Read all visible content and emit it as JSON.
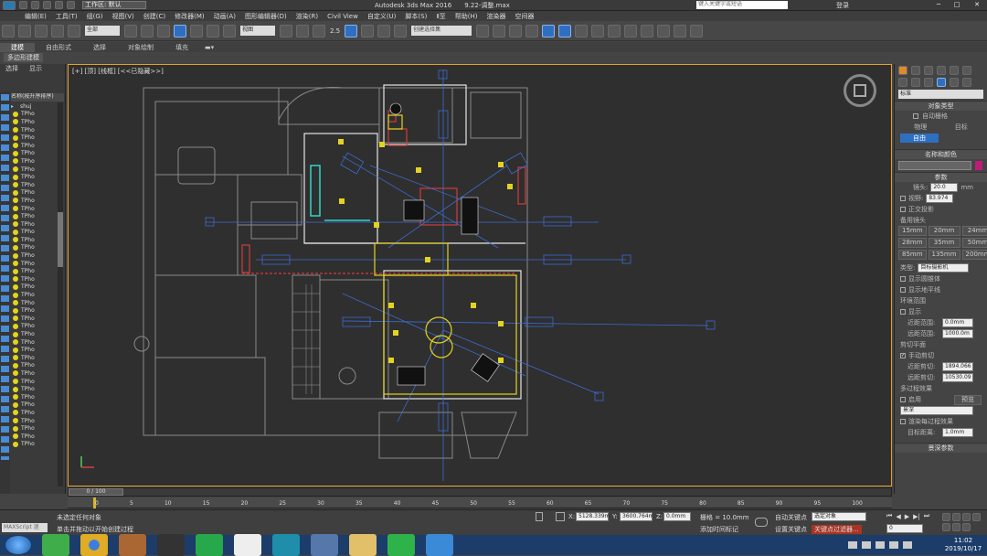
{
  "title_bar": {
    "workspace": "工作区: 默认",
    "app_title": "Autodesk 3ds Max 2016",
    "file_name": "9.22-调整.max",
    "search_placeholder": "键入关键字或短语",
    "user": "登录"
  },
  "menu": [
    "编辑(E)",
    "工具(T)",
    "组(G)",
    "视图(V)",
    "创建(C)",
    "修改器(M)",
    "动画(A)",
    "图形编辑器(D)",
    "渲染(R)",
    "Civil View",
    "自定义(U)",
    "脚本(S)",
    "Ⅱ至",
    "帮助(H)",
    "渲染器",
    "空间器"
  ],
  "main_toolbar": {
    "selection_filter": "全部",
    "view_dropdown": "视图",
    "named_selection": "创建选择集",
    "snap_label": "2.5"
  },
  "ribbon_tabs": [
    "建模",
    "自由形式",
    "选择",
    "对象绘制",
    "填充"
  ],
  "ribbon_sub": "多边形建模",
  "scene_explorer": {
    "tabs": [
      "选择",
      "显示"
    ],
    "column_header": "名称(按升序排序)",
    "first_item": "shuj",
    "items": [
      "TPho",
      "TPho",
      "TPho",
      "TPho",
      "TPho",
      "TPho",
      "TPho",
      "TPho",
      "TPho",
      "TPho",
      "TPho",
      "TPho",
      "TPho",
      "TPho",
      "TPho",
      "TPho",
      "TPho",
      "TPho",
      "TPho",
      "TPho",
      "TPho",
      "TPho",
      "TPho",
      "TPho",
      "TPho",
      "TPho",
      "TPho",
      "TPho",
      "TPho",
      "TPho",
      "TPho",
      "TPho",
      "TPho",
      "TPho",
      "TPho",
      "TPho",
      "TPho",
      "TPho",
      "TPho",
      "TPho",
      "TPho",
      "TPho",
      "TPho"
    ]
  },
  "viewport": {
    "label": "[+] [顶] [线框] [<<已隐藏>>]"
  },
  "command_panel": {
    "dropdown": "标准",
    "object_type_header": "对象类型",
    "auto_grid": "自动栅格",
    "btn_physical": "物理",
    "btn_target": "目标",
    "btn_free": "自由",
    "name_color_header": "名称和颜色",
    "params_header": "参数",
    "lens_label": "镜头:",
    "lens_value": "20.0",
    "lens_unit": "mm",
    "fov_label": "视野:",
    "fov_value": "83.974",
    "ortho": "正交投影",
    "stock_lenses": "备用镜头",
    "lenses": [
      "15mm",
      "20mm",
      "24mm",
      "28mm",
      "35mm",
      "50mm",
      "85mm",
      "135mm",
      "200mm"
    ],
    "type_label": "类型:",
    "type_value": "目标摄影机",
    "show_cone": "显示圆锥体",
    "show_horizon": "显示地平线",
    "env_range": "环境范围",
    "show": "显示",
    "near_range_label": "近距范围:",
    "near_range_value": "0.0mm",
    "far_range_label": "远距范围:",
    "far_range_value": "1000.0m",
    "clip_header": "剪切平面",
    "manual_clip": "手动剪切",
    "near_clip_label": "近距剪切:",
    "near_clip_value": "1894.066",
    "far_clip_label": "远距剪切:",
    "far_clip_value": "10530.09",
    "multipass_header": "多过程效果",
    "enable": "启用",
    "preview": "预览",
    "effect_value": "景深",
    "render_each": "渲染每过程效果",
    "target_dist_label": "目标距离:",
    "target_dist_value": "1.0mm",
    "dof_header": "景深参数"
  },
  "timeline": {
    "frame": "0 / 100",
    "ticks": [
      "0",
      "5",
      "10",
      "15",
      "20",
      "25",
      "30",
      "35",
      "40",
      "45",
      "50",
      "55",
      "60",
      "65",
      "70",
      "75",
      "80",
      "85",
      "90",
      "95",
      "100"
    ]
  },
  "status": {
    "maxscript": "MAXScript 迷",
    "line1": "未选定任何对象",
    "line2": "单击并拖动以开始创建过程",
    "x_value": "5128.339m",
    "y_value": "3600.764m",
    "z_value": "0.0mm",
    "grid": "栅格 = 10.0mm",
    "auto_key": "自动关键点",
    "selected_obj": "选定对象",
    "set_key": "设置关键点",
    "key_filter": "关键点过滤器...",
    "add_time_tag": "添加时间标记",
    "frame_field": "0"
  },
  "taskbar": {
    "time": "11:02",
    "date": "2019/10/17"
  },
  "colors": {
    "viewport_bg": "#2f2f2f",
    "accent_blue": "#2f6fc2",
    "drawing_blue": "#3d6fd8",
    "drawing_yellow": "#e4d31f",
    "drawing_red": "#d23b3b",
    "drawing_cyan": "#31d8c7"
  }
}
